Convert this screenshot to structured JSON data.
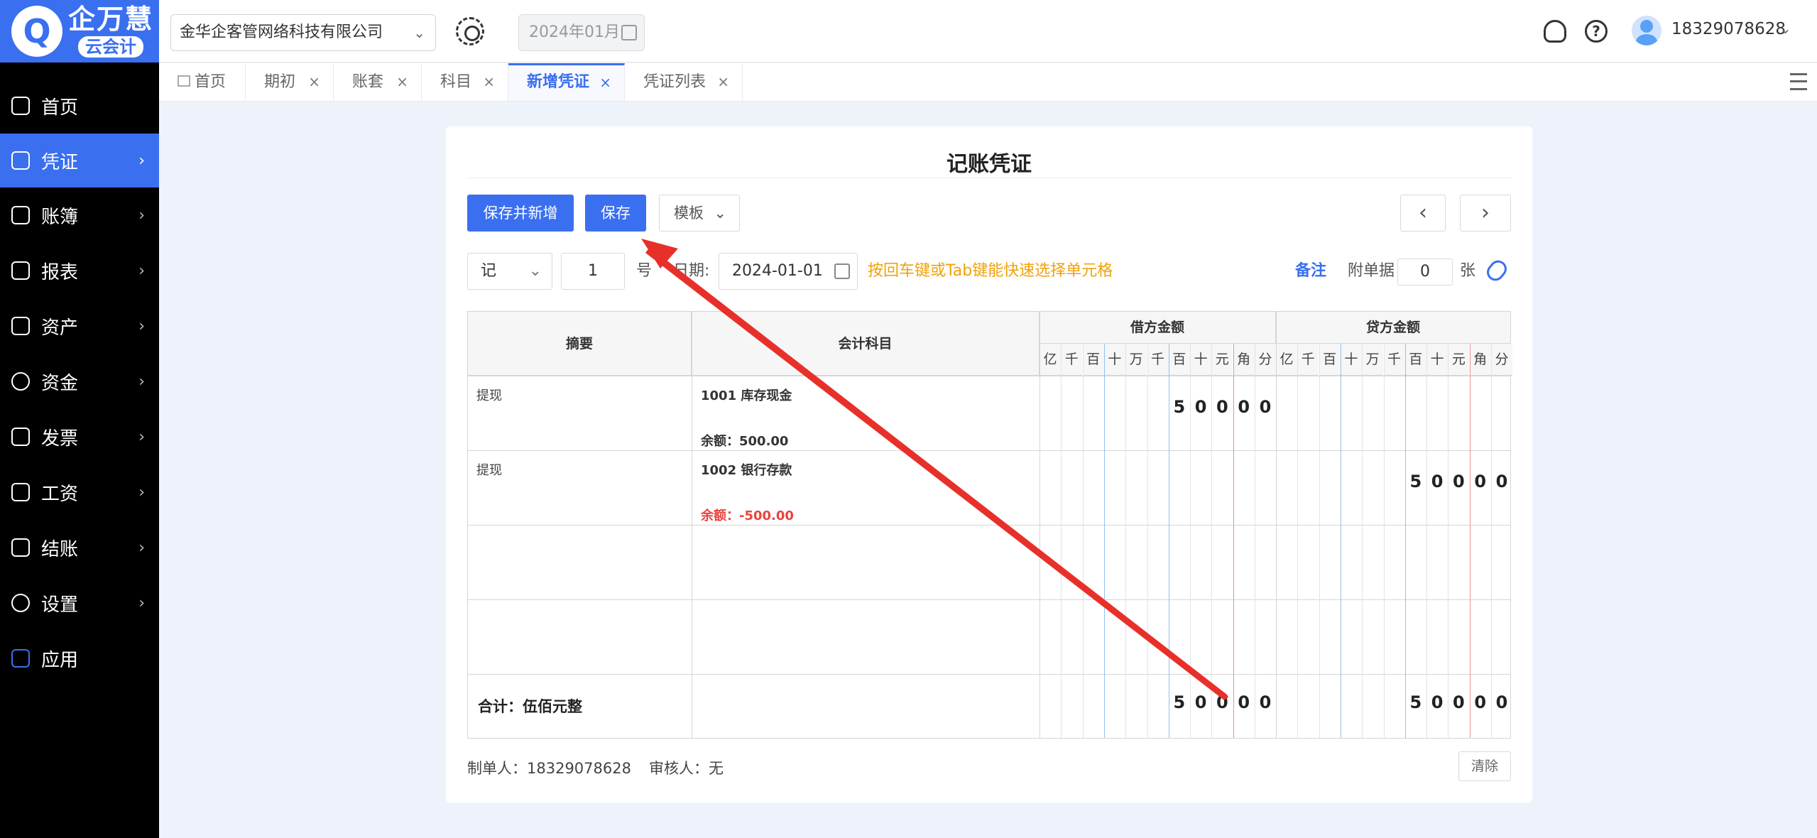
{
  "app": {
    "logo_title": "企万慧",
    "logo_subtitle": "云会计",
    "logo_mark": "Q"
  },
  "sidebar": {
    "items": [
      {
        "label": "首页",
        "icon": "home-icon",
        "active": false,
        "has_arrow": false
      },
      {
        "label": "凭证",
        "icon": "voucher-icon",
        "active": true,
        "has_arrow": true
      },
      {
        "label": "账簿",
        "icon": "ledger-icon",
        "active": false,
        "has_arrow": true
      },
      {
        "label": "报表",
        "icon": "report-icon",
        "active": false,
        "has_arrow": true
      },
      {
        "label": "资产",
        "icon": "asset-icon",
        "active": false,
        "has_arrow": true
      },
      {
        "label": "资金",
        "icon": "fund-icon",
        "active": false,
        "has_arrow": true
      },
      {
        "label": "发票",
        "icon": "invoice-icon",
        "active": false,
        "has_arrow": true
      },
      {
        "label": "工资",
        "icon": "salary-icon",
        "active": false,
        "has_arrow": true
      },
      {
        "label": "结账",
        "icon": "closing-icon",
        "active": false,
        "has_arrow": true
      },
      {
        "label": "设置",
        "icon": "settings-icon",
        "active": false,
        "has_arrow": true
      },
      {
        "label": "应用",
        "icon": "app-icon",
        "active": false,
        "has_arrow": false
      }
    ],
    "chevron": "›"
  },
  "header": {
    "company": "金华企客管网络科技有限公司",
    "period": "2024年01月",
    "username": "18329078628",
    "help_glyph": "?"
  },
  "tabs": [
    {
      "label": "首页",
      "closable": false,
      "active": false
    },
    {
      "label": "期初",
      "closable": true,
      "active": false
    },
    {
      "label": "账套",
      "closable": true,
      "active": false
    },
    {
      "label": "科目",
      "closable": true,
      "active": false
    },
    {
      "label": "新增凭证",
      "closable": true,
      "active": true
    },
    {
      "label": "凭证列表",
      "closable": true,
      "active": false
    }
  ],
  "close_glyph": "×",
  "voucher": {
    "title": "记账凭证",
    "buttons": {
      "save_and_new": "保存并新增",
      "save": "保存",
      "template": "模板"
    },
    "nav": {
      "prev": "‹",
      "next": "›"
    },
    "word": "记",
    "number": "1",
    "number_suffix": "号",
    "date_label": "日期:",
    "date": "2024-01-01",
    "hint": "按回车键或Tab键能快速选择单元格",
    "remark": "备注",
    "attach_label": "附单据",
    "attach_count": "0",
    "attach_unit": "张",
    "headers": {
      "summary": "摘要",
      "account": "会计科目",
      "debit": "借方金额",
      "credit": "贷方金额",
      "digits": [
        "亿",
        "千",
        "百",
        "十",
        "万",
        "千",
        "百",
        "十",
        "元",
        "角",
        "分"
      ]
    },
    "rows": [
      {
        "summary": "提现",
        "account": "1001 库存现金",
        "balance": "余额：500.00",
        "balance_negative": false,
        "debit_digits": [
          "5",
          "0",
          "0",
          "0",
          "0"
        ],
        "credit_digits": []
      },
      {
        "summary": "提现",
        "account": "1002 银行存款",
        "balance": "余额：-500.00",
        "balance_negative": true,
        "debit_digits": [],
        "credit_digits": [
          "5",
          "0",
          "0",
          "0",
          "0"
        ]
      },
      {
        "summary": "",
        "account": "",
        "balance": "",
        "balance_negative": false,
        "debit_digits": [],
        "credit_digits": []
      },
      {
        "summary": "",
        "account": "",
        "balance": "",
        "balance_negative": false,
        "debit_digits": [],
        "credit_digits": []
      }
    ],
    "total_label": "合计：伍佰元整",
    "total_debit_digits": [
      "5",
      "0",
      "0",
      "0",
      "0"
    ],
    "total_credit_digits": [
      "5",
      "0",
      "0",
      "0",
      "0"
    ],
    "maker": "制单人：18329078628",
    "auditor": "审核人：无",
    "clear": "清除"
  },
  "colors": {
    "accent": "#3a6ff0",
    "hint": "#f0a20a",
    "negative": "#e8433e",
    "annotation_arrow": "#e8302a"
  }
}
